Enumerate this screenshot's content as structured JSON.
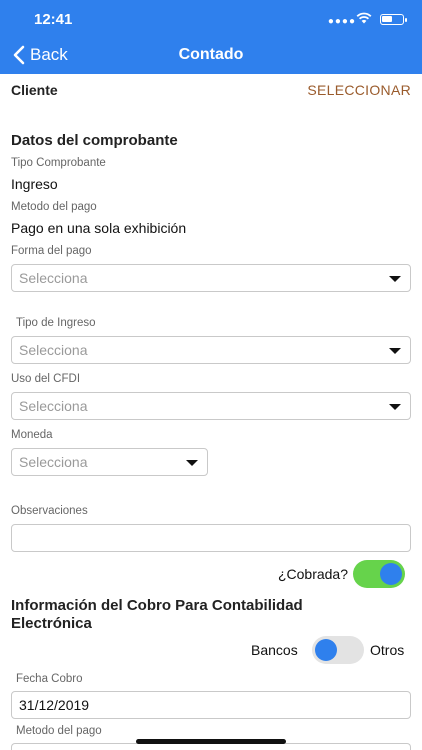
{
  "status": {
    "time": "12:41"
  },
  "nav": {
    "back_label": "Back",
    "title": "Contado"
  },
  "cliente": {
    "label": "Cliente",
    "action": "SELECCIONAR"
  },
  "comprobante": {
    "section_title": "Datos del comprobante",
    "tipo_label": "Tipo Comprobante",
    "tipo_value": "Ingreso",
    "metodo_label": "Metodo del pago",
    "metodo_value": "Pago en una sola exhibición",
    "forma_label": "Forma del pago",
    "forma_placeholder": "Selecciona",
    "tipo_ingreso_label": "Tipo de Ingreso",
    "tipo_ingreso_placeholder": "Selecciona",
    "uso_label": "Uso del CFDI",
    "uso_placeholder": "Selecciona",
    "moneda_label": "Moneda",
    "moneda_placeholder": "Selecciona",
    "observaciones_label": "Observaciones",
    "observaciones_value": ""
  },
  "cobrada": {
    "label": "¿Cobrada?",
    "checked": true
  },
  "cobro": {
    "section_title_line1": "Información del Cobro Para Contabilidad",
    "section_title_line2": "Electrónica",
    "bancos_label": "Bancos",
    "otros_label": "Otros",
    "fecha_label": "Fecha Cobro",
    "fecha_value": "31/12/2019",
    "metodo_label": "Metodo del pago"
  },
  "colors": {
    "accent": "#2f80ed",
    "toggle_on": "#66d34b",
    "link": "#9a5b2c"
  }
}
